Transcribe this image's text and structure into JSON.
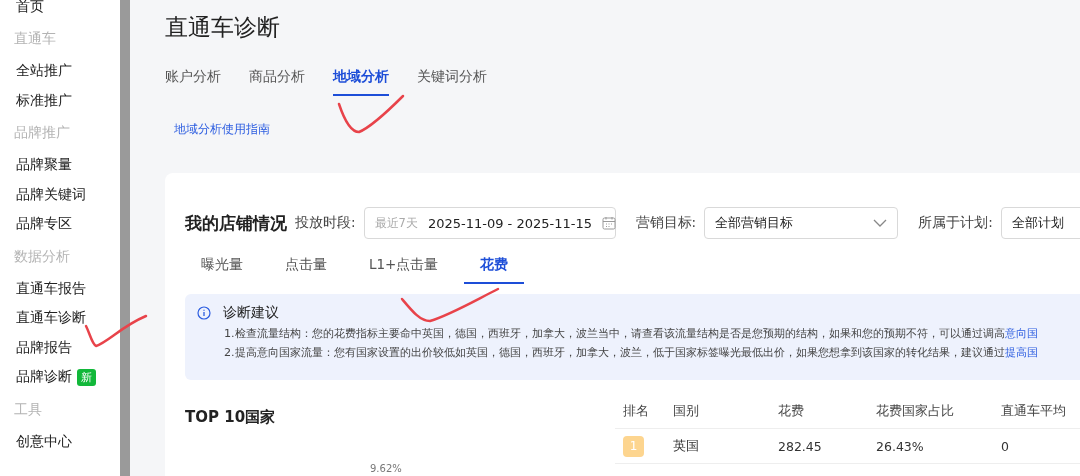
{
  "sidebar": {
    "items": [
      {
        "kind": "item",
        "label": "首页"
      },
      {
        "kind": "group",
        "label": "直通车"
      },
      {
        "kind": "item",
        "label": "全站推广"
      },
      {
        "kind": "item",
        "label": "标准推广"
      },
      {
        "kind": "group",
        "label": "品牌推广"
      },
      {
        "kind": "item",
        "label": "品牌聚量"
      },
      {
        "kind": "item",
        "label": "品牌关键词"
      },
      {
        "kind": "item",
        "label": "品牌专区"
      },
      {
        "kind": "group",
        "label": "数据分析"
      },
      {
        "kind": "item",
        "label": "直通车报告"
      },
      {
        "kind": "item",
        "label": "直通车诊断"
      },
      {
        "kind": "item",
        "label": "品牌报告"
      },
      {
        "kind": "item",
        "label": "品牌诊断",
        "badge": "新"
      },
      {
        "kind": "group",
        "label": "工具"
      },
      {
        "kind": "item",
        "label": "创意中心"
      }
    ]
  },
  "title": "直通车诊断",
  "tabs": [
    {
      "label": "账户分析",
      "selected": false
    },
    {
      "label": "商品分析",
      "selected": false
    },
    {
      "label": "地域分析",
      "selected": true
    },
    {
      "label": "关键词分析",
      "selected": false
    }
  ],
  "guide_link": "地域分析使用指南",
  "card": {
    "heading": "我的店铺情况",
    "date_filter": {
      "label": "投放时段:",
      "preset": "最近7天",
      "value": "2025-11-09 - 2025-11-15"
    },
    "selects": [
      {
        "label": "营销目标:",
        "value": "全部营销目标"
      },
      {
        "label": "所属于计划:",
        "value": "全部计划"
      }
    ],
    "metric_tabs": [
      {
        "label": "曝光量",
        "selected": false
      },
      {
        "label": "点击量",
        "selected": false
      },
      {
        "label": "L1+点击量",
        "selected": false
      },
      {
        "label": "花费",
        "selected": true
      }
    ],
    "advice": {
      "title": "诊断建议",
      "lines": [
        {
          "text": "1.检查流量结构：您的花费指标主要命中英国，德国，西班牙，加拿大，波兰当中，请查看该流量结构是否是您预期的结构，如果和您的预期不符，可以通过调高",
          "link": "意向国"
        },
        {
          "text": "2.提高意向国家流量：您有国家设置的出价较低如英国，德国，西班牙，加拿大，波兰，低于国家标签曝光最低出价，如果您想拿到该国家的转化结果，建议通过",
          "link": "提高国"
        }
      ]
    },
    "top10_title": "TOP 10国家",
    "chart_label": "9.62%",
    "table": {
      "columns": [
        "排名",
        "国别",
        "花费",
        "花费国家占比",
        "直通车平均"
      ],
      "rows": [
        {
          "cells": [
            "1",
            "英国",
            "282.45",
            "26.43%",
            "0"
          ]
        }
      ]
    }
  }
}
